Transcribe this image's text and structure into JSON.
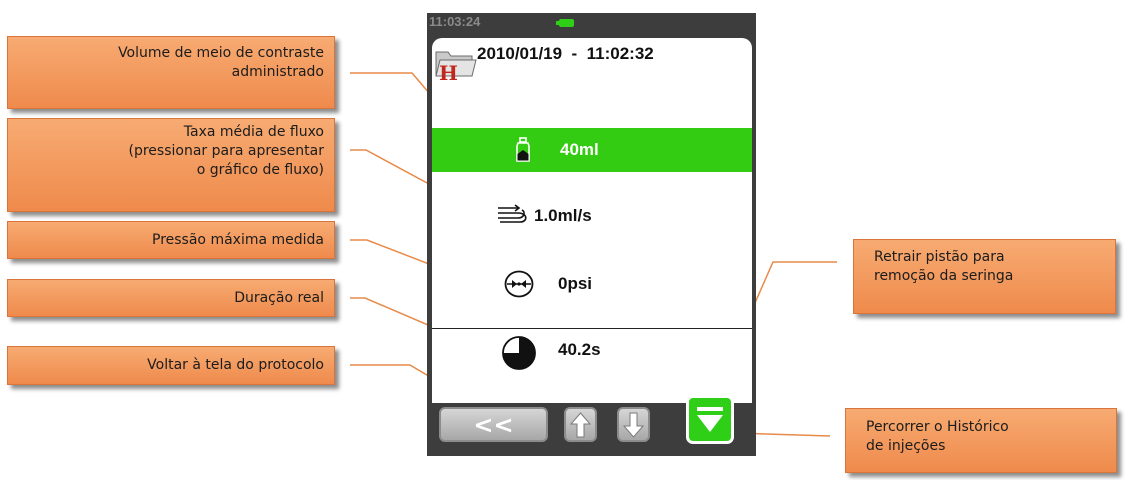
{
  "status": {
    "time": "11:03:24"
  },
  "header": {
    "timestamp": "2010/01/19  -  11:02:32"
  },
  "rows": {
    "volume": {
      "value": "40ml"
    },
    "flow": {
      "value": "1.0ml/s"
    },
    "pressure": {
      "value": "0psi"
    },
    "duration": {
      "value": "40.2s"
    }
  },
  "buttons": {
    "back_label": "<<"
  },
  "callouts": {
    "volume": {
      "line1": "Volume de meio de contraste",
      "line2": "administrado"
    },
    "flow": {
      "line1": "Taxa média de fluxo",
      "line2": "(pressionar para apresentar",
      "line3": "o gráfico de fluxo)"
    },
    "pressure": {
      "line1": "Pressão máxima medida"
    },
    "duration": {
      "line1": "Duração real"
    },
    "back": {
      "line1": "Voltar à tela do protocolo"
    },
    "retract": {
      "line1": "Retrair pistão para",
      "line2": "remoção da seringa"
    },
    "scroll": {
      "line1": "Percorrer o Histórico",
      "line2": "de injeções"
    }
  },
  "colors": {
    "accent_green": "#33cc12",
    "callout_orange": "#f29a5e",
    "leader_orange": "#e88a4a",
    "device_bezel": "#3d3d3d"
  },
  "icons": {
    "volume": "syringe-bottle-icon",
    "flow": "flow-lines-icon",
    "pressure": "pressure-gauge-icon",
    "duration": "pie-timer-icon",
    "folder": "history-folder-icon",
    "battery": "battery-icon"
  }
}
